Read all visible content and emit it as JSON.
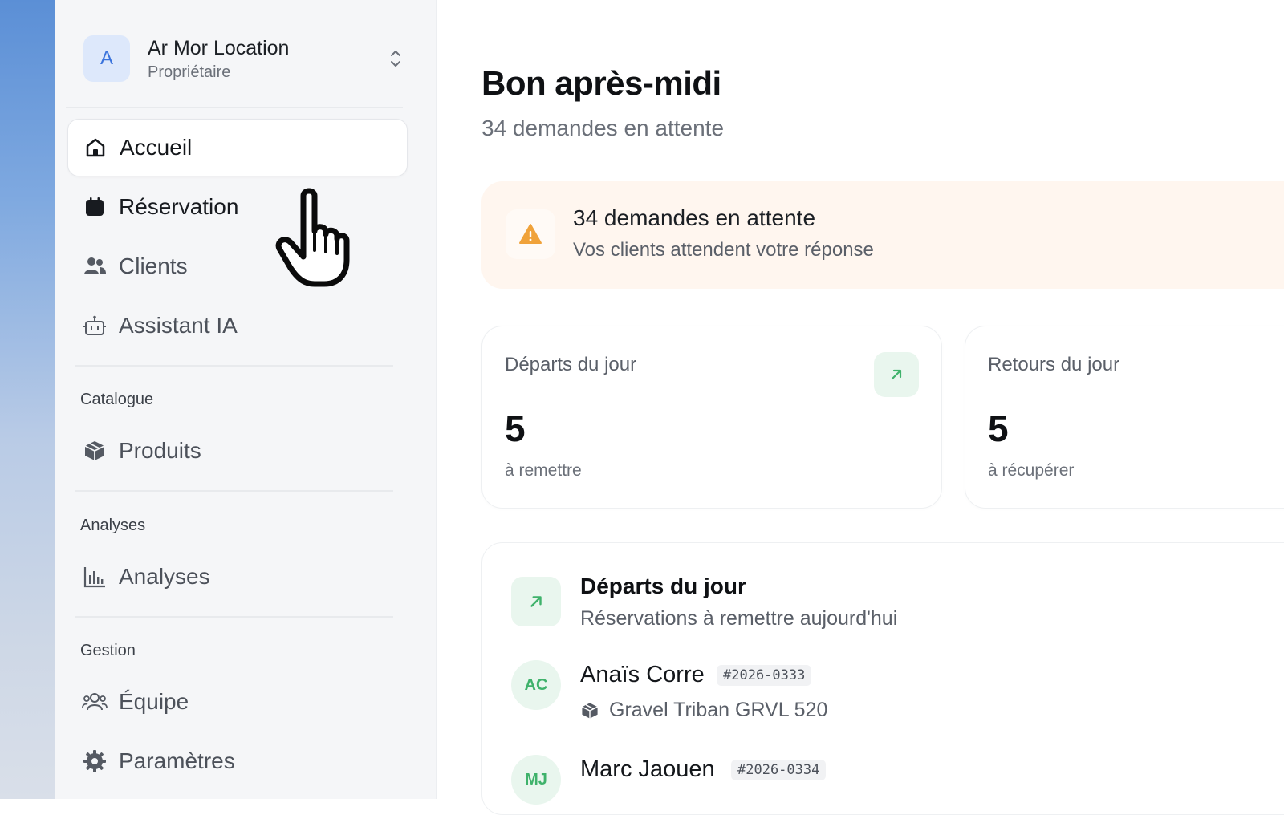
{
  "org": {
    "avatar_letter": "A",
    "name": "Ar Mor Location",
    "role": "Propriétaire"
  },
  "nav": {
    "primary": [
      {
        "label": "Accueil",
        "icon": "home-icon",
        "active": true
      },
      {
        "label": "Réservation",
        "icon": "calendar-icon"
      },
      {
        "label": "Clients",
        "icon": "users-icon"
      },
      {
        "label": "Assistant IA",
        "icon": "robot-icon"
      }
    ],
    "sections": [
      {
        "label": "Catalogue",
        "items": [
          {
            "label": "Produits",
            "icon": "package-icon"
          }
        ]
      },
      {
        "label": "Analyses",
        "items": [
          {
            "label": "Analyses",
            "icon": "bar-chart-icon"
          }
        ]
      },
      {
        "label": "Gestion",
        "items": [
          {
            "label": "Équipe",
            "icon": "team-icon"
          },
          {
            "label": "Paramètres",
            "icon": "gear-icon"
          }
        ]
      }
    ]
  },
  "main": {
    "greeting": "Bon après-midi",
    "subtitle": "34 demandes en attente",
    "alert": {
      "icon": "warning-icon",
      "title": "34 demandes en attente",
      "text": "Vos clients attendent votre réponse"
    },
    "stats": [
      {
        "title": "Départs du jour",
        "value": "5",
        "sub": "à remettre",
        "icon": "arrow-up-right-icon"
      },
      {
        "title": "Retours du jour",
        "value": "5",
        "sub": "à récupérer"
      }
    ],
    "departures": {
      "title": "Départs du jour",
      "subtitle": "Réservations à remettre aujourd'hui",
      "rows": [
        {
          "initials": "AC",
          "name": "Anaïs Corre",
          "ref": "#2026-0333",
          "product": "Gravel Triban GRVL 520"
        },
        {
          "initials": "MJ",
          "name": "Marc Jaouen",
          "ref": "#2026-0334",
          "product": ""
        }
      ]
    }
  },
  "colors": {
    "accent_blue": "#3a73dc",
    "alert_bg": "#fff6ef",
    "warning": "#f0a23a",
    "success": "#3fb26b"
  }
}
